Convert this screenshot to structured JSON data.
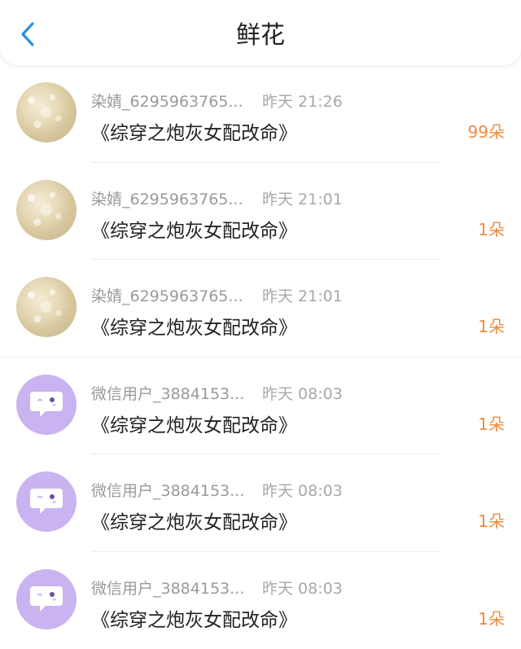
{
  "header": {
    "title": "鲜花",
    "back_icon": "chevron-left-icon",
    "accent": "#2b8fe6"
  },
  "colors": {
    "count": "#f08a3c",
    "name": "#9a9a9a",
    "wechat_avatar_bg": "#c9b3f0"
  },
  "items": [
    {
      "avatar": "photo",
      "name": "染婧_6295963765...",
      "time": "昨天 21:26",
      "book": "《综穿之炮灰女配改命》",
      "count": "99朵"
    },
    {
      "avatar": "photo",
      "name": "染婧_6295963765...",
      "time": "昨天 21:01",
      "book": "《综穿之炮灰女配改命》",
      "count": "1朵"
    },
    {
      "avatar": "photo",
      "name": "染婧_6295963765...",
      "time": "昨天 21:01",
      "book": "《综穿之炮灰女配改命》",
      "count": "1朵"
    },
    {
      "avatar": "wechat",
      "name": "微信用户_3884153...",
      "time": "昨天 08:03",
      "book": "《综穿之炮灰女配改命》",
      "count": "1朵"
    },
    {
      "avatar": "wechat",
      "name": "微信用户_3884153...",
      "time": "昨天 08:03",
      "book": "《综穿之炮灰女配改命》",
      "count": "1朵"
    },
    {
      "avatar": "wechat",
      "name": "微信用户_3884153...",
      "time": "昨天 08:03",
      "book": "《综穿之炮灰女配改命》",
      "count": "1朵"
    }
  ]
}
